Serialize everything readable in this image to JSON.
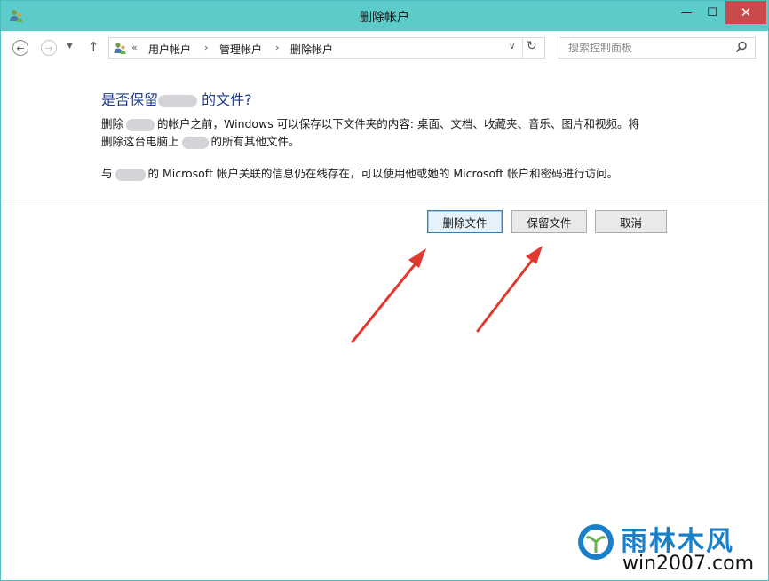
{
  "window": {
    "title": "删除帐户",
    "minimize_glyph": "—",
    "maximize_glyph": "☐",
    "close_glyph": "✕"
  },
  "nav": {
    "back_glyph": "←",
    "forward_glyph": "→",
    "recent_glyph": "▼",
    "up_glyph": "↑",
    "crumb_prefix": "«",
    "crumbs": [
      "用户帐户",
      "管理帐户",
      "删除帐户"
    ],
    "crumb_separator": "›",
    "address_dropdown_glyph": "∨",
    "refresh_glyph": "↻",
    "search_placeholder": "搜索控制面板"
  },
  "dialog": {
    "heading_before": "是否保留",
    "heading_after": " 的文件?",
    "para1_part1": "删除",
    "para1_part2": "的帐户之前，Windows 可以保存以下文件夹的内容: 桌面、文档、收藏夹、音乐、图片和视频。将",
    "para1_line2_part1": "删除这台电脑上",
    "para1_line2_part2": "的所有其他文件。",
    "para2_part1": "与",
    "para2_part2": "的 Microsoft 帐户关联的信息仍在线存在，可以使用他或她的 Microsoft 帐户和密码进行访问。"
  },
  "buttons": {
    "delete_files": "删除文件",
    "keep_files": "保留文件",
    "cancel": "取消"
  },
  "watermark": {
    "brand": "雨林木风",
    "url": "win2007.com"
  },
  "colors": {
    "titlebar": "#5ccccb",
    "heading": "#1e3a8a",
    "close_button": "#c94a4a",
    "arrow": "#e0392f",
    "brand_blue": "#1a7fc9"
  }
}
